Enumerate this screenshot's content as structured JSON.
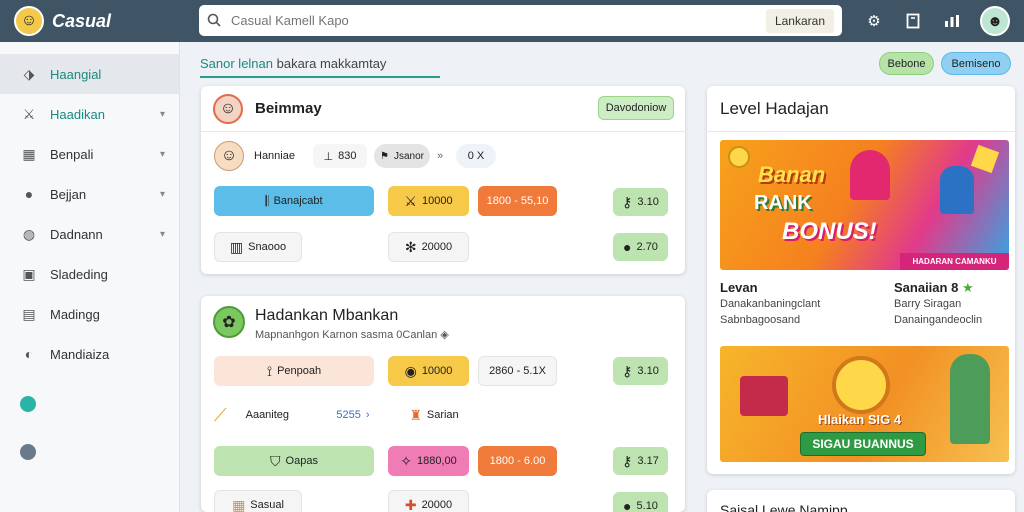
{
  "app": {
    "title": "Casual"
  },
  "search": {
    "placeholder": "Casual Kamell Kapo",
    "button": "Lankaran"
  },
  "topbar": {
    "icons": [
      "gear-icon",
      "bookmark-icon",
      "chart-icon",
      "user-avatar"
    ]
  },
  "sidebar": {
    "items": [
      {
        "label": "Haangial",
        "icon": "tag-icon",
        "active": true,
        "teal": true,
        "chevron": false
      },
      {
        "label": "Haadikan",
        "icon": "sword-icon",
        "active": false,
        "teal": true,
        "chevron": true
      },
      {
        "label": "Benpali",
        "icon": "grid-icon",
        "active": false,
        "teal": false,
        "chevron": true
      },
      {
        "label": "Bejjan",
        "icon": "chat-icon",
        "active": false,
        "teal": false,
        "chevron": true
      },
      {
        "label": "Dadnann",
        "icon": "globe-icon",
        "active": false,
        "teal": false,
        "chevron": true
      },
      {
        "label": "Sladeding",
        "icon": "image-icon",
        "active": false,
        "teal": false,
        "chevron": false
      },
      {
        "label": "Madingg",
        "icon": "calendar-icon",
        "active": false,
        "teal": false,
        "chevron": false
      },
      {
        "label": "Mandiaiza",
        "icon": "refresh-icon",
        "active": false,
        "teal": false,
        "chevron": false
      }
    ],
    "dots": [
      "#2ab4a8",
      "#6b7a8a"
    ]
  },
  "main": {
    "heading_accent": "Sanor lelnan",
    "heading_rest": " bakara makkamtay",
    "btn_green": "Bebone",
    "btn_blue": "Bemiseno"
  },
  "card1": {
    "title": "Beimmay",
    "badge": "Davodoniow",
    "user_label": "Hanniae",
    "stat1": "830",
    "stat2": "Jsanor",
    "stat3": "0 X",
    "row1": {
      "c1": "Banajcabt",
      "c2": "10000",
      "c3": "1800 - 55,10",
      "c4": "3.10"
    },
    "row2": {
      "c1": "Snaooo",
      "c2": "20000",
      "c4": "2.70"
    }
  },
  "card2": {
    "title": "Hadankan Mbankan",
    "subtitle": "Mapnanhgon Karnon sasma 0Canlan",
    "row1": {
      "c1": "Penpoah",
      "c2": "10000",
      "c3": "2860 - 5.1X",
      "c4": "3.10"
    },
    "row2": {
      "c1": "Aaaniteg",
      "c2": "5255",
      "c3": "Sarian"
    },
    "row3": {
      "c1": "Oapas",
      "c2": "1880,00",
      "c3": "1800 - 6.00",
      "c4": "3.17"
    },
    "row4": {
      "c1": "Sasual",
      "c2": "20000",
      "c4": "5.10"
    }
  },
  "right": {
    "title": "Level Hadajan",
    "banner1": {
      "line1": "Banan",
      "line2": "RANK",
      "line3": "BONUS!",
      "strip": "HADARAN CAMANKU"
    },
    "info_left": {
      "title": "Levan",
      "l1": "Danakanbaningclant",
      "l2": "Sabnbagoosand"
    },
    "info_right": {
      "title": "Sanaiian 8",
      "l1": "Barry Siragan",
      "l2": "Danaingandeoclin"
    },
    "banner2": {
      "line1": "Hlaikan SIG 4",
      "button": "SIGAU BUANNUS"
    },
    "footer_title": "Saisal Lewe Namipp"
  },
  "colors": {
    "topbar": "#3f5565",
    "teal": "#1a8a7f",
    "blue_chip": "#5bbde8",
    "yellow_chip": "#f7c948",
    "orange_chip": "#f07a3a",
    "green_chip": "#bde4b0",
    "pink_chip": "#f07cb5"
  }
}
